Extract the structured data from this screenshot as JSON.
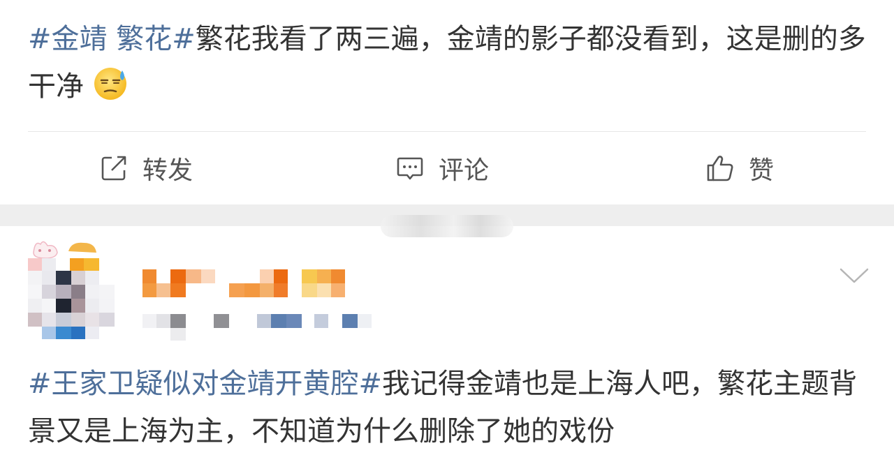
{
  "post1": {
    "tags": "#金靖 繁花#",
    "text": "繁花我看了两三遍，金靖的影子都没看到，这是删的多干净"
  },
  "actions": {
    "repost": "转发",
    "comment": "评论",
    "like": "赞"
  },
  "post2": {
    "tags": "#王家卫疑似对金靖开黄腔#",
    "text": "我记得金靖也是上海人吧，繁花主题背景又是上海为主，不知道为什么删除了她的戏份"
  },
  "icons": {
    "emoji": "tired-sweat-face-emoji",
    "repost": "share-icon",
    "comment": "comment-icon",
    "like": "thumbs-up-icon",
    "menu": "chevron-down-icon"
  },
  "colors": {
    "topic_link": "#4e6f9a",
    "text": "#333333",
    "separator": "#eeeeee"
  }
}
